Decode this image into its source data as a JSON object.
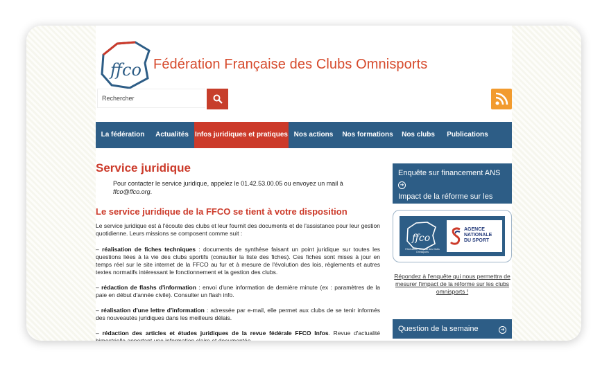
{
  "site": {
    "title": "Fédération Française des Clubs Omnisports",
    "logo_text": "ffco"
  },
  "search": {
    "placeholder": "Rechercher"
  },
  "nav": [
    {
      "label": "La fédération",
      "active": false
    },
    {
      "label": "Actualités",
      "active": false
    },
    {
      "label": "Infos juridiques et pratiques",
      "active": true
    },
    {
      "label": "Nos actions",
      "active": false
    },
    {
      "label": "Nos formations",
      "active": false
    },
    {
      "label": "Nos clubs",
      "active": false
    },
    {
      "label": "Publications",
      "active": false
    }
  ],
  "main": {
    "title": "Service juridique",
    "contact_prefix": "Pour contacter le service juridique, appelez le 01.42.53.00.05 ou envoyez un mail à ",
    "contact_email": "ffco@ffco.org",
    "contact_suffix": ".",
    "subtitle": "Le service juridique de la FFCO se tient à votre disposition",
    "intro": "Le service juridique est à l'écoute des clubs et leur fournit des documents et de l'assistance pour leur gestion quotidienne. Leurs missions se composent comme suit :",
    "items": [
      {
        "prefix": "– ",
        "bold": "réalisation de fiches techniques",
        "text": " : documents de synthèse faisant un point juridique sur toutes les questions liées à la vie des clubs sportifs (consulter la liste des fiches). Ces fiches sont mises à jour en temps réel sur le site internet de la FFCO au fur et à mesure de l'évolution des lois, règlements et autres textes normatifs intéressant le fonctionnement et la gestion des clubs."
      },
      {
        "prefix": "– ",
        "bold": "rédaction de flashs d'information",
        "text": " : envoi d'une information de dernière minute (ex : paramètres de la paie en début d'année civile). Consulter un flash info."
      },
      {
        "prefix": "– ",
        "bold": "réalisation d'une lettre d'information",
        "text": " : adressée par e-mail, elle permet aux clubs de se tenir informés des nouveautés juridiques dans les meilleurs délais."
      },
      {
        "prefix": "– ",
        "bold": "rédaction des articles et études juridiques de la revue fédérale FFCO Infos",
        "text": ". Revue d'actualité bimestrielle apportant une information claire et documentée."
      }
    ]
  },
  "sidebar": {
    "enquete_line1": "Enquête sur financement ANS",
    "enquete_line2": "Impact de la réforme sur les clubs omnisports",
    "ans_ffco_caption": "Fédération Française des Clubs Omnisports",
    "ans_line1": "AGENCE",
    "ans_line2": "NATIONALE",
    "ans_line3": "DU SPORT",
    "survey_link": "Répondez à l'enquête qui nous permettra de mesurer l'impact de la réforme sur les clubs omnisports !",
    "question_label": "Question de la semaine"
  },
  "colors": {
    "brand_red": "#cc3a2a",
    "nav_blue": "#2d5d86",
    "rss_orange": "#f29b2e"
  }
}
